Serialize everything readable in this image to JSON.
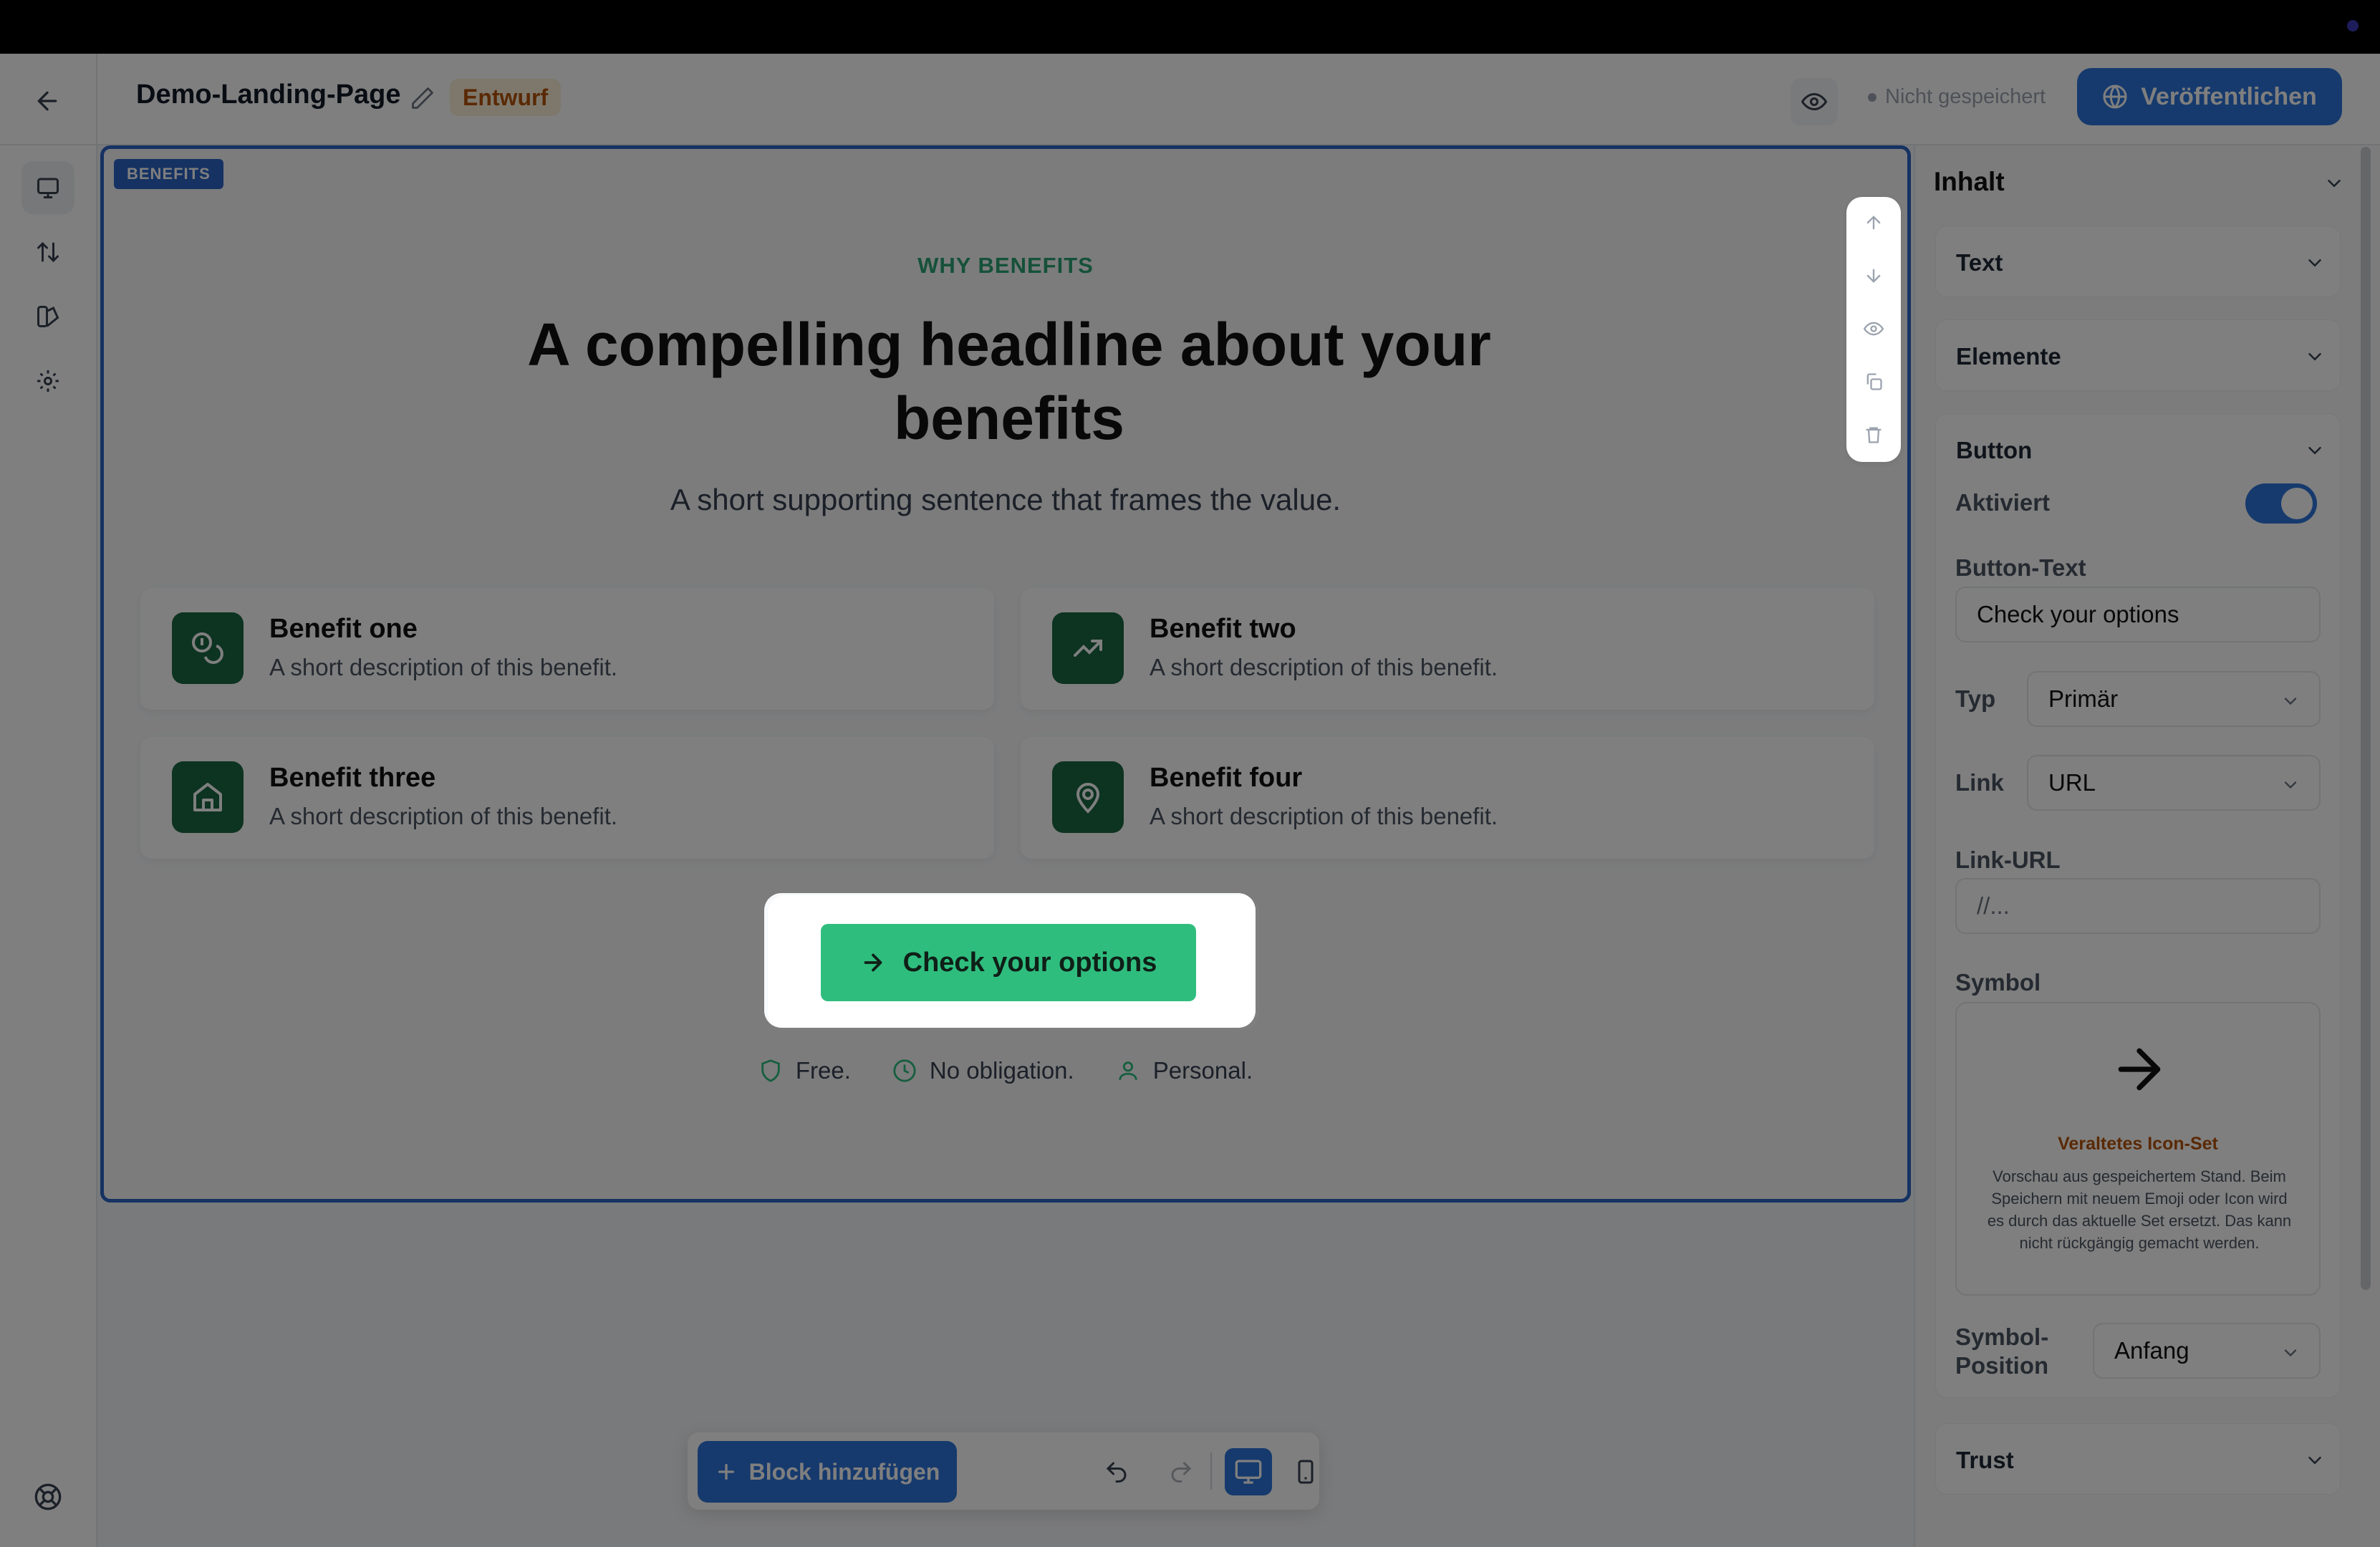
{
  "header": {
    "page_title": "Demo-Landing-Page",
    "status_badge": "Entwurf",
    "save_status": "Nicht gespeichert",
    "publish_label": "Veröffentlichen"
  },
  "block": {
    "tag": "BENEFITS",
    "eyebrow": "WHY BENEFITS",
    "headline": "A compelling headline about your benefits",
    "subline": "A short supporting sentence that frames the value.",
    "cards": [
      {
        "title": "Benefit one",
        "desc": "A short description of this benefit.",
        "icon": "coins-icon"
      },
      {
        "title": "Benefit two",
        "desc": "A short description of this benefit.",
        "icon": "trending-up-icon"
      },
      {
        "title": "Benefit three",
        "desc": "A short description of this benefit.",
        "icon": "home-icon"
      },
      {
        "title": "Benefit four",
        "desc": "A short description of this benefit.",
        "icon": "map-pin-icon"
      }
    ],
    "cta_label": "Check your options",
    "trust": [
      "Free.",
      "No obligation.",
      "Personal."
    ]
  },
  "toolbar": {
    "add_block_label": "Block hinzufügen"
  },
  "panel": {
    "title": "Inhalt",
    "sections": {
      "text": "Text",
      "elemente": "Elemente",
      "button": "Button",
      "trust": "Trust"
    },
    "button": {
      "activated_label": "Aktiviert",
      "activated": true,
      "text_label": "Button-Text",
      "text_value": "Check your options",
      "type_label": "Typ",
      "type_value": "Primär",
      "link_label": "Link",
      "link_value": "URL",
      "link_url_label": "Link-URL",
      "link_url_value": "//...",
      "symbol_label": "Symbol",
      "symbol_warning": "Veraltetes Icon-Set",
      "symbol_desc": "Vorschau aus gespeichertem Stand. Beim Speichern mit neuem Emoji oder Icon wird es durch das aktuelle Set ersetzt. Das kann nicht rückgängig gemacht werden.",
      "symbol_position_label_1": "Symbol-",
      "symbol_position_label_2": "Position",
      "symbol_position_value": "Anfang"
    }
  },
  "colors": {
    "accent": "#2d74da",
    "green": "#2fbd7e",
    "dark_green": "#1a6643",
    "draft": "#b45309"
  }
}
